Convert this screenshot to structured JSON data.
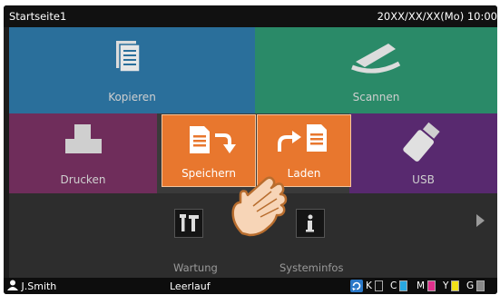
{
  "topbar": {
    "title": "Startseite1",
    "datetime": "20XX/XX/XX(Mo) 10:00"
  },
  "tiles": {
    "kopieren": "Kopieren",
    "scannen": "Scannen",
    "drucken": "Drucken",
    "speichern": "Speichern",
    "laden": "Laden",
    "usb": "USB"
  },
  "tools": {
    "wartung": "Wartung",
    "systeminfos": "Systeminfos"
  },
  "status": {
    "user": "J.Smith",
    "state": "Leerlauf",
    "inks": [
      {
        "label": "K",
        "color": "#111111"
      },
      {
        "label": "C",
        "color": "#29a8e0"
      },
      {
        "label": "M",
        "color": "#e0308c"
      },
      {
        "label": "Y",
        "color": "#f2e21a"
      },
      {
        "label": "G",
        "color": "#888888"
      }
    ]
  },
  "colors": {
    "orange": "#e8772e",
    "blue": "#2a6f9b",
    "green": "#2a8a68",
    "magenta": "#9a3f7f",
    "purple": "#7a3a9a"
  }
}
